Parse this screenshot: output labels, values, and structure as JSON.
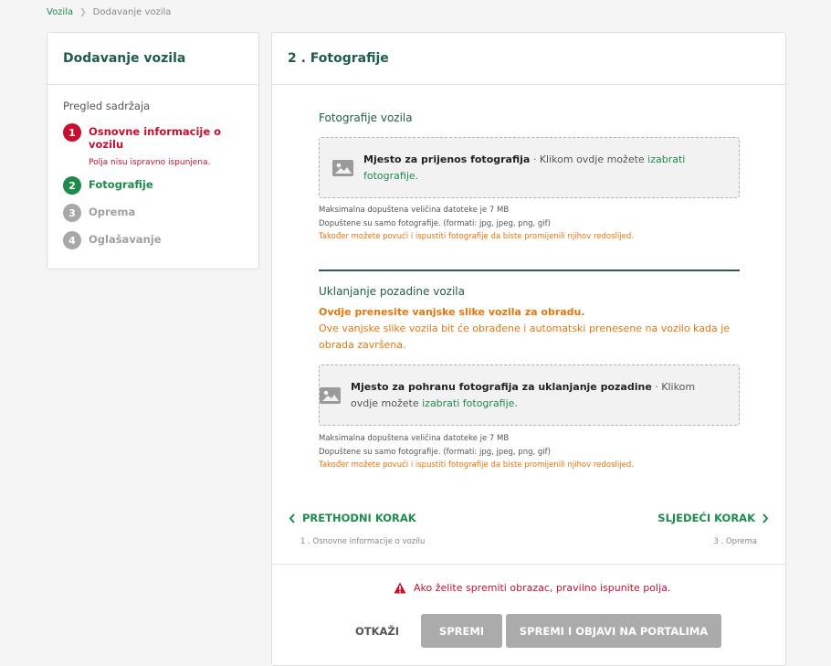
{
  "breadcrumb": {
    "root": "Vozila",
    "current": "Dodavanje vozila"
  },
  "sidebar": {
    "title": "Dodavanje vozila",
    "toc_title": "Pregled sadržaja",
    "steps": [
      {
        "num": "1",
        "label": "Osnovne informacije o vozilu",
        "error": "Polja nisu ispravno ispunjena."
      },
      {
        "num": "2",
        "label": "Fotografije"
      },
      {
        "num": "3",
        "label": "Oprema"
      },
      {
        "num": "4",
        "label": "Oglašavanje"
      }
    ]
  },
  "main": {
    "title": "2 . Fotografije",
    "photos": {
      "section_title": "Fotografije vozila",
      "dropzone_bold": "Mjesto za prijenos fotografija",
      "dropzone_text": " · Klikom ovdje možete ",
      "dropzone_link": "izabrati fotografije.",
      "note_size": "Maksimalna dopuštena veličina datoteke je 7 MB",
      "note_formats": "Dopuštene su samo fotografije. (formati: jpg, jpeg, png, gif)",
      "note_reorder": "Također možete povući i ispustiti fotografije da biste promijenili njihov redoslijed."
    },
    "background": {
      "section_title": "Uklanjanje pozadine vozila",
      "warning_bold": "Ovdje prenesite vanjske slike vozila za obradu.",
      "warning_text": "Ove vanjske slike vozila bit će obrađene i automatski prenesene na vozilo kada je obrada završena.",
      "dropzone_bold": "Mjesto za pohranu fotografija za uklanjanje pozadine",
      "dropzone_text": " · Klikom ovdje možete ",
      "dropzone_link": "izabrati fotografije.",
      "note_size": "Maksimalna dopuštena veličina datoteke je 7 MB",
      "note_formats": "Dopuštene su samo fotografije. (formati: jpg, jpeg, png, gif)",
      "note_reorder": "Također možete povući i ispustiti fotografije da biste promijenili njihov redoslijed."
    },
    "nav": {
      "prev_label": "PRETHODNI KORAK",
      "prev_sub": "1 . Osnovne informacije o vozilu",
      "next_label": "SLJEDEĆI KORAK",
      "next_sub": "3 . Oprema"
    },
    "footer": {
      "error_text": "Ako želite spremiti obrazac, pravilno ispunite polja.",
      "cancel_label": "OTKAŽI",
      "save_label": "SPREMI",
      "publish_label": "SPREMI I OBJAVI NA PORTALIMA"
    }
  },
  "colors": {
    "accent_green": "#1e8a4c",
    "title_green": "#1f5d45",
    "error_red": "#c8102e",
    "warning_orange": "#e8750a",
    "disabled_gray": "#ababab"
  }
}
